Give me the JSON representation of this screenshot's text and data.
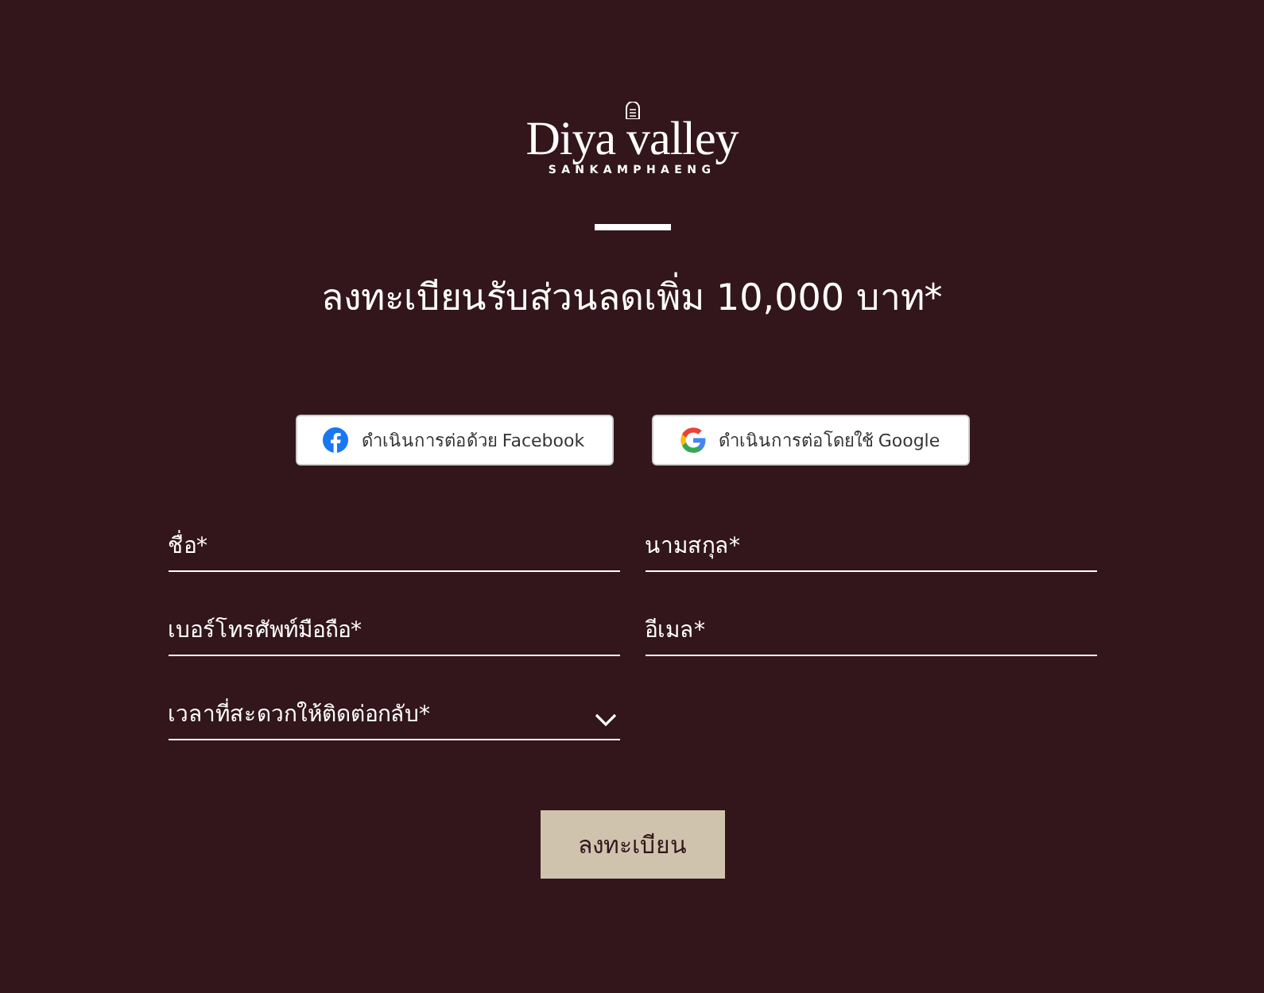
{
  "logo": {
    "name": "Diya valley",
    "subtitle": "SANKAMPHAENG"
  },
  "heading": "ลงทะเบียนรับส่วนลดเพิ่ม 10,000 บาท*",
  "social_buttons": [
    {
      "kind": "facebook",
      "label": "ดำเนินการต่อด้วย Facebook"
    },
    {
      "kind": "google",
      "label": "ดำเนินการต่อโดยใช้ Google"
    }
  ],
  "fields": [
    {
      "kind": "text",
      "placeholder": "ชื่อ*"
    },
    {
      "kind": "text",
      "placeholder": "นามสกุล*"
    },
    {
      "kind": "text",
      "placeholder": "เบอร์โทรศัพท์มือถือ*"
    },
    {
      "kind": "text",
      "placeholder": "อีเมล*"
    },
    {
      "kind": "select",
      "placeholder": "เวลาที่สะดวกให้ติดต่อกลับ*"
    }
  ],
  "submit_button": "ลงทะเบียน"
}
